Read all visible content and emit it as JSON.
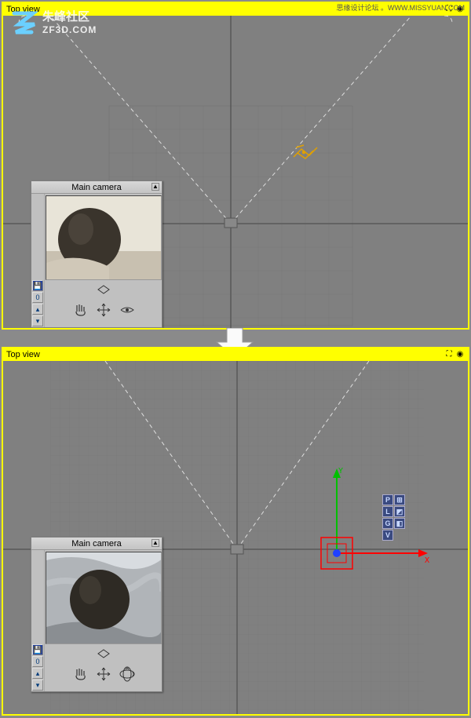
{
  "watermark": {
    "line1": "朱峰社区",
    "line2": "ZF3D.COM",
    "right": "思缘设计论坛 。WWW.MISSYUAN.COM"
  },
  "top": {
    "title": "Top view",
    "panel": {
      "title": "Main camera"
    },
    "light_present": true
  },
  "bottom": {
    "title": "Top view",
    "panel": {
      "title": "Main camera"
    },
    "gizmo": {
      "x_label": "X",
      "y_label": "Y"
    },
    "toggles": [
      "P",
      "L",
      "G",
      "V"
    ]
  }
}
